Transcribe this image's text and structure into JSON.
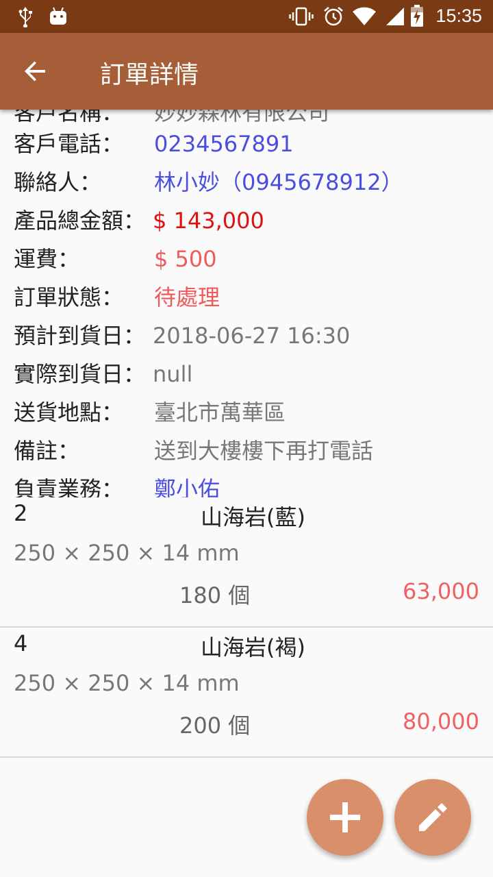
{
  "status_bar": {
    "time": "15:35",
    "icons": [
      "usb-icon",
      "android-debug-icon",
      "vibrate-icon",
      "alarm-icon",
      "wifi-icon",
      "signal-icon",
      "battery-charging-icon"
    ]
  },
  "app_bar": {
    "title": "訂單詳情",
    "back_icon": "arrow-back-icon"
  },
  "order_info": [
    {
      "label": "客戶名稱：",
      "value": "妙妙森林有限公司"
    },
    {
      "label": "客戶電話：",
      "value": "0234567891"
    },
    {
      "label": "聯絡人：",
      "value": "林小妙（0945678912）"
    },
    {
      "label": "產品總金額：",
      "value": "$ 143,000"
    },
    {
      "label": "運費：",
      "value": "$ 500"
    },
    {
      "label": "訂單狀態：",
      "value": "待處理"
    },
    {
      "label": "預計到貨日：",
      "value": "2018-06-27 16:30"
    },
    {
      "label": "實際到貨日：",
      "value": "null"
    },
    {
      "label": "送貨地點：",
      "value": "臺北市萬華區"
    },
    {
      "label": "備註：",
      "value": "送到大樓樓下再打電話"
    },
    {
      "label": "負責業務：",
      "value": "鄭小佑"
    }
  ],
  "items": [
    {
      "qty": "2",
      "name": "山海岩(藍)",
      "spec": "250 × 250 ×  14 mm",
      "count": "180 個",
      "price": "63,000"
    },
    {
      "qty": "4",
      "name": "山海岩(褐)",
      "spec": "250 × 250 ×  14 mm",
      "count": "200 個",
      "price": "80,000"
    }
  ],
  "fabs": {
    "add_icon": "plus-icon",
    "edit_icon": "pencil-icon"
  },
  "colors": {
    "status_bar": "#7a3a14",
    "app_bar": "#a65e38",
    "fab": "#d9906a",
    "link_blue": "#4a4ee0",
    "total_red": "#e01010",
    "accent_pink": "#f05a5a"
  }
}
